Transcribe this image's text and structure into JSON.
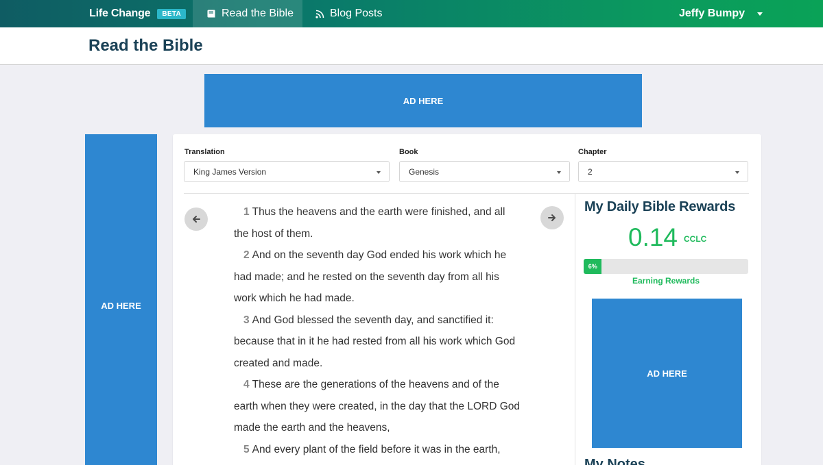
{
  "nav": {
    "brand": "Life Change",
    "beta": "BETA",
    "read_the_bible": "Read the Bible",
    "blog_posts": "Blog Posts",
    "user": "Jeffy Bumpy"
  },
  "page": {
    "title": "Read the Bible"
  },
  "ads": {
    "top": "AD HERE",
    "left": "AD HERE",
    "right": "AD HERE"
  },
  "filters": {
    "translation_label": "Translation",
    "translation_value": "King James Version",
    "book_label": "Book",
    "book_value": "Genesis",
    "chapter_label": "Chapter",
    "chapter_value": "2"
  },
  "verses": [
    {
      "num": "1",
      "text": "Thus the heavens and the earth were finished, and all the host of them."
    },
    {
      "num": "2",
      "text": "And on the seventh day God ended his work which he had made; and he rested on the seventh day from all his work which he had made."
    },
    {
      "num": "3",
      "text": "And God blessed the seventh day, and sanctified it: because that in it he had rested from all his work which God created and made."
    },
    {
      "num": "4",
      "text": "These are the generations of the heavens and of the earth when they were created, in the day that the LORD God made the earth and the heavens,"
    },
    {
      "num": "5",
      "text": "And every plant of the field before it was in the earth,"
    }
  ],
  "rewards": {
    "title": "My Daily Bible Rewards",
    "amount": "0.14",
    "unit": "CCLC",
    "progress_label": "6%",
    "progress_fraction": 0.06,
    "status": "Earning Rewards"
  },
  "notes": {
    "title": "My Notes"
  },
  "colors": {
    "accent_green": "#1fba5c",
    "ad_blue": "#2e87d1",
    "title_navy": "#1a4156"
  }
}
